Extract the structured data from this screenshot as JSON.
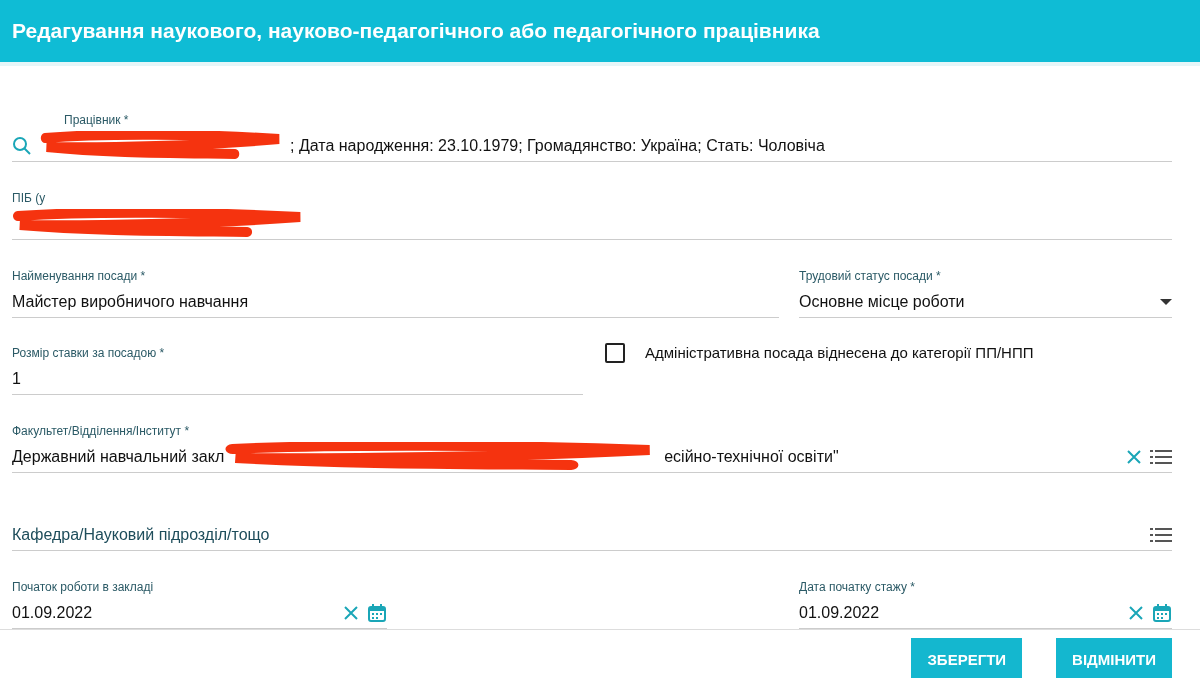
{
  "window": {
    "title": "Редагування наукового, науково-педагогічного або педагогічного працівника"
  },
  "rows": [
    {
      "fields": [
        {
          "kind": "lookup",
          "label": "Працівник *",
          "redacted": true,
          "value_tail": "; Дата народження: 23.10.1979; Громадянство: Україна; Стать: Чоловіча"
        }
      ]
    },
    {
      "fields": [
        {
          "kind": "text",
          "label": "ПІБ (у",
          "redacted": true
        }
      ]
    },
    {
      "fields": [
        {
          "kind": "text",
          "label": "Найменування посади *",
          "value_head": "Майстер виробничого навчання"
        },
        {
          "kind": "select",
          "label": "Трудовий статус посади *",
          "value_head": "Основне місце роботи"
        }
      ]
    },
    {
      "fields": [
        {
          "kind": "text",
          "label": "Розмір ставки за посадою *",
          "value_head": "1"
        },
        {
          "kind": "checkbox",
          "label": "Адміністративна посада віднесена до категорії ПП/НПП",
          "checked": false
        }
      ]
    },
    {
      "fields": [
        {
          "kind": "list",
          "label": "Факультет/Відділення/Інститут *",
          "value_head": "Державний навчальний закл",
          "redacted": true,
          "value_tail": "есійно-технічної освіти\"",
          "clearable": true
        }
      ]
    },
    {
      "fields": [
        {
          "kind": "list",
          "placeholder": "Кафедра/Науковий підрозділ/тощо"
        }
      ]
    },
    {
      "fields": [
        {
          "kind": "date",
          "label": "Початок роботи в закладі",
          "value_head": "01.09.2022"
        },
        {
          "kind": "date",
          "label": "Дата початку стажу *",
          "value_head": "01.09.2022"
        }
      ]
    }
  ],
  "buttons": [
    "ЗБЕРЕГТИ",
    "ВІДМІНИТИ"
  ]
}
